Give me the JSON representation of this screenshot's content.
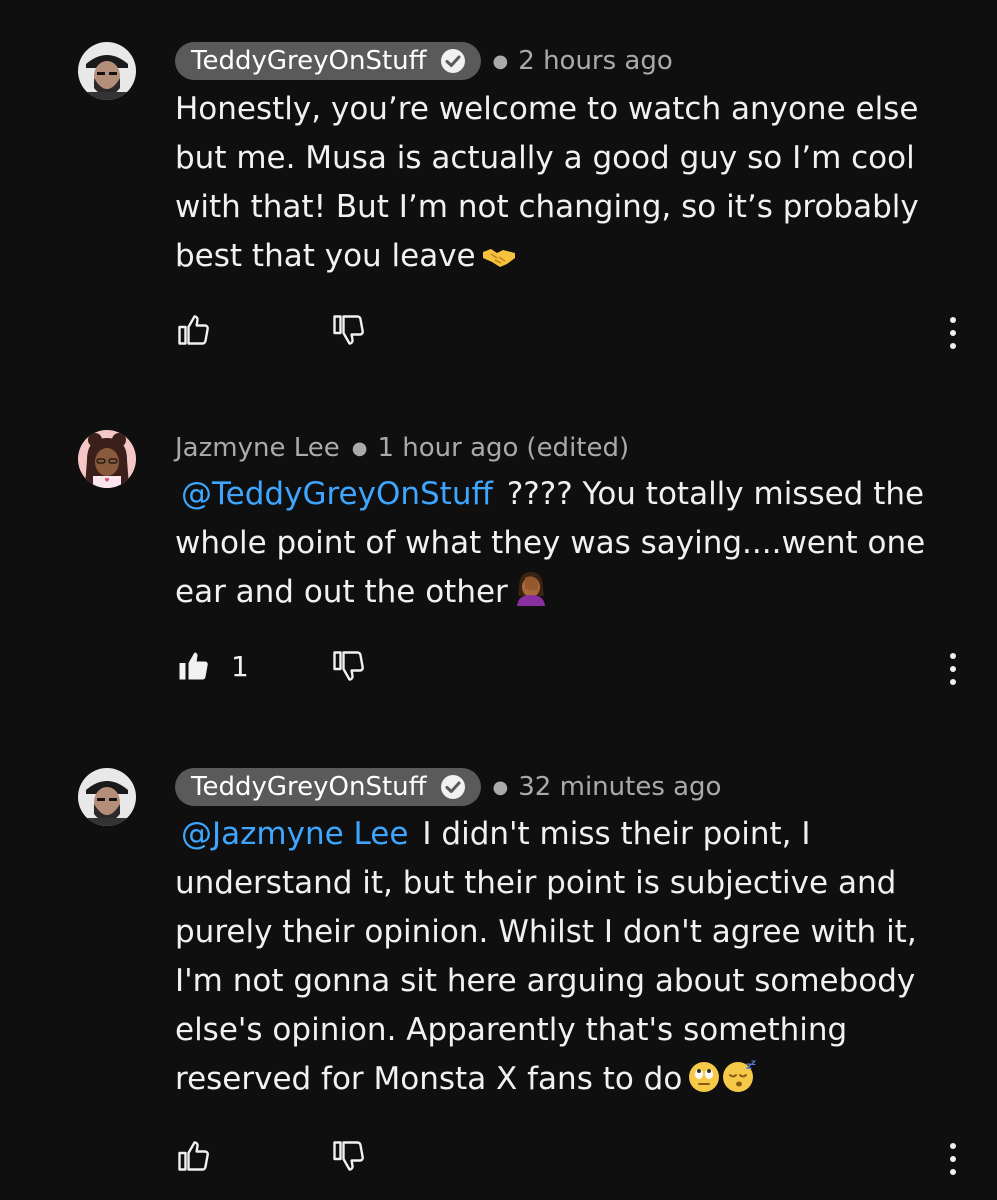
{
  "comments": [
    {
      "author": "TeddyGreyOnStuff",
      "verified": true,
      "time": "2 hours ago",
      "edited": "",
      "mention": "",
      "text": "Honestly, you’re welcome to watch anyone else but me. Musa is actually a good guy so I’m cool with that! But I’m not changing, so it’s probably best that you leave",
      "emoji": "handshake",
      "likes": "",
      "liked": false
    },
    {
      "author": "Jazmyne Lee",
      "verified": false,
      "time": "1 hour ago",
      "edited": "(edited)",
      "mention": "@TeddyGreyOnStuff",
      "text": "???? You totally missed the whole point of what they was saying....went one ear and out the other",
      "emoji": "woman-facepalming",
      "likes": "1",
      "liked": true
    },
    {
      "author": "TeddyGreyOnStuff",
      "verified": true,
      "time": "32 minutes ago",
      "edited": "",
      "mention": "@Jazmyne Lee",
      "text": "I didn't miss their point, I understand it, but their point is subjective and purely their opinion. Whilst I don't agree with it, I'm not gonna sit here arguing about somebody else's opinion. Apparently that's something reserved for Monsta X fans to do",
      "emoji": "face-with-rolling-eyes, sleeping-face",
      "likes": "",
      "liked": false
    }
  ],
  "colors": {
    "background": "#0f0f0f",
    "text": "#f1f1f1",
    "secondary": "#aaaaaa",
    "mention": "#3ea6ff",
    "author_chip": "#5a5a5a"
  }
}
